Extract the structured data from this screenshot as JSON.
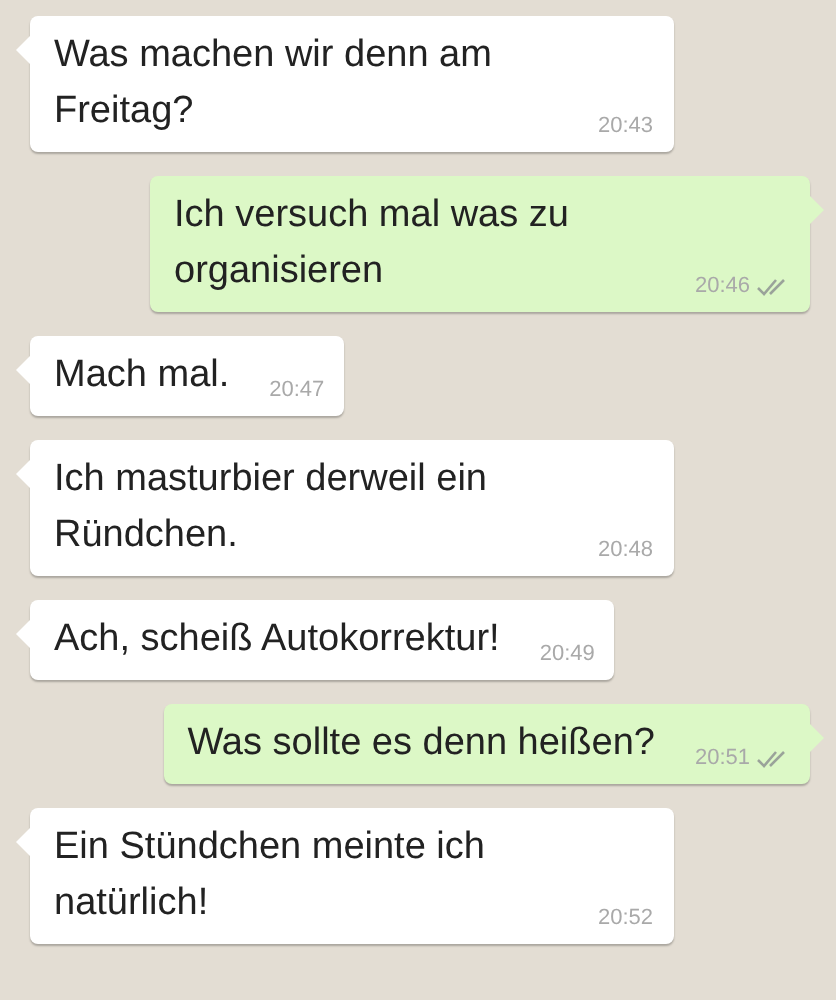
{
  "messages": [
    {
      "kind": "incoming",
      "text": "Was machen wir denn am Freitag?",
      "time": "20:43"
    },
    {
      "kind": "outgoing",
      "text": "Ich versuch mal was zu organisieren",
      "time": "20:46",
      "delivered": true
    },
    {
      "kind": "incoming",
      "text": "Mach mal.",
      "time": "20:47"
    },
    {
      "kind": "incoming",
      "text": "Ich masturbier derweil ein Ründchen.",
      "time": "20:48"
    },
    {
      "kind": "incoming",
      "text": "Ach, scheiß Autokorrektur!",
      "time": "20:49"
    },
    {
      "kind": "outgoing",
      "text": "Was sollte es denn heißen?",
      "time": "20:51",
      "delivered": true
    },
    {
      "kind": "incoming",
      "text": "Ein Stündchen meinte ich natürlich!",
      "time": "20:52"
    }
  ]
}
